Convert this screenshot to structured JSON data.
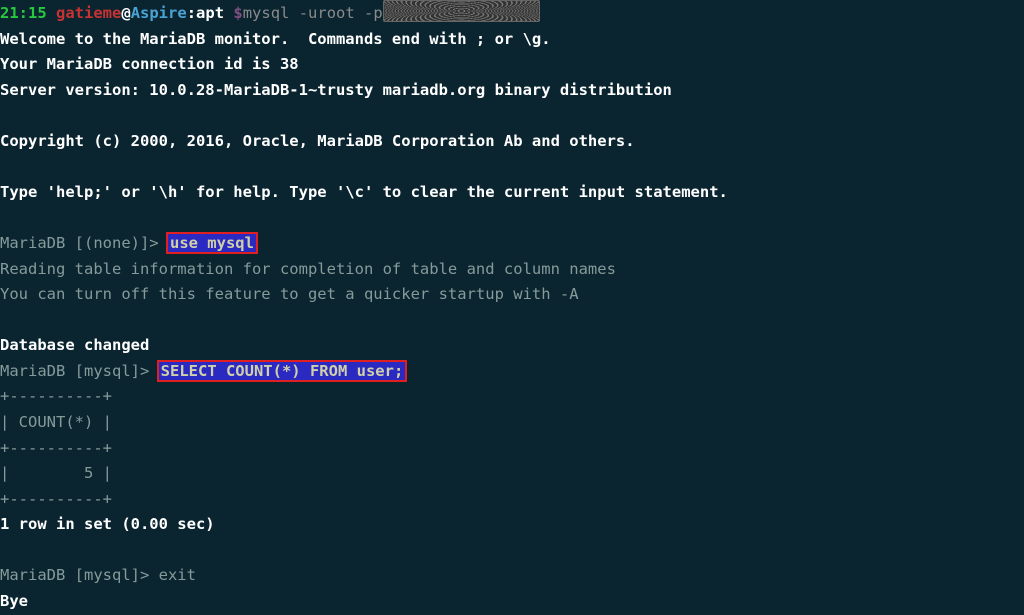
{
  "prompt": {
    "time": "21:15",
    "user": "gatieme",
    "at": "@",
    "host": "Aspire",
    "sep": ":",
    "cwd": "apt",
    "dollar": " $",
    "cmd": "mysql -uroot -p"
  },
  "welcome": {
    "l1": "Welcome to the MariaDB monitor.  Commands end with ; or \\g.",
    "l2": "Your MariaDB connection id is 38",
    "l3": "Server version: 10.0.28-MariaDB-1~trusty mariadb.org binary distribution",
    "copyright": "Copyright (c) 2000, 2016, Oracle, MariaDB Corporation Ab and others.",
    "help": "Type 'help;' or '\\h' for help. Type '\\c' to clear the current input statement."
  },
  "db": {
    "prompt_none": "MariaDB [(none)]>",
    "use_cmd": "use mysql",
    "reading": "Reading table information for completion of table and column names",
    "turnoff": "You can turn off this feature to get a quicker startup with -A",
    "changed": "Database changed",
    "prompt_mysql": "MariaDB [mysql]>",
    "select_cmd": "SELECT COUNT(*) FROM user;",
    "tborder": "+----------+",
    "theader": "| COUNT(*) |",
    "trow": "|        5 |",
    "rows": "1 row in set (0.00 sec)",
    "exit_cmd": " exit",
    "bye": "Bye"
  }
}
